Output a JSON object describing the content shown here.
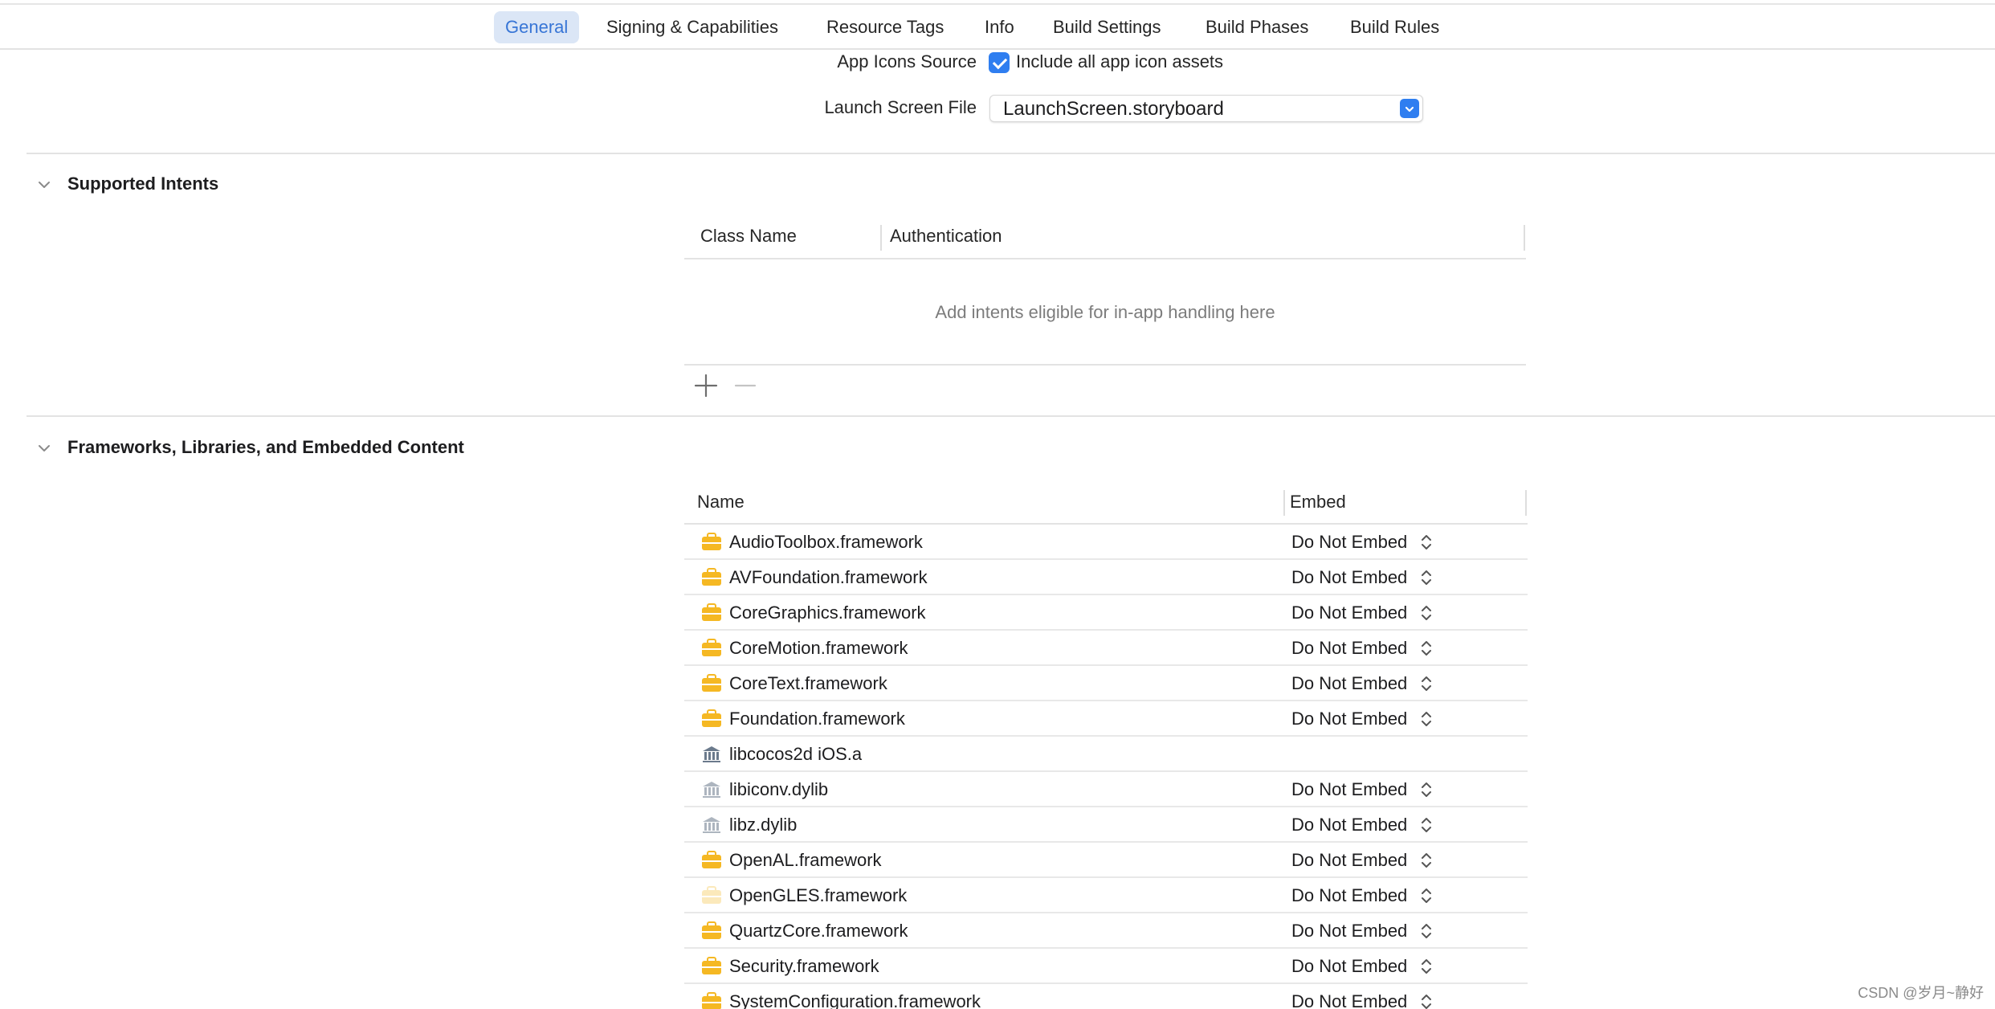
{
  "tabs": [
    {
      "label": "General",
      "active": true
    },
    {
      "label": "Signing & Capabilities",
      "active": false
    },
    {
      "label": "Resource Tags",
      "active": false
    },
    {
      "label": "Info",
      "active": false
    },
    {
      "label": "Build Settings",
      "active": false
    },
    {
      "label": "Build Phases",
      "active": false
    },
    {
      "label": "Build Rules",
      "active": false
    }
  ],
  "app_icons": {
    "label": "App Icons Source",
    "checkbox_label": "Include all app icon assets",
    "checked": true
  },
  "launch_screen": {
    "label": "Launch Screen File",
    "value": "LaunchScreen.storyboard"
  },
  "supported_intents": {
    "title": "Supported Intents",
    "columns": [
      "Class Name",
      "Authentication"
    ],
    "empty_message": "Add intents eligible for in-app handling here",
    "add_symbol": "+",
    "remove_symbol": "−"
  },
  "frameworks": {
    "title": "Frameworks, Libraries, and Embedded Content",
    "columns": [
      "Name",
      "Embed"
    ],
    "rows": [
      {
        "name": "AudioToolbox.framework",
        "embed": "Do Not Embed",
        "icon": "toolbox-icon"
      },
      {
        "name": "AVFoundation.framework",
        "embed": "Do Not Embed",
        "icon": "toolbox-icon"
      },
      {
        "name": "CoreGraphics.framework",
        "embed": "Do Not Embed",
        "icon": "toolbox-icon"
      },
      {
        "name": "CoreMotion.framework",
        "embed": "Do Not Embed",
        "icon": "toolbox-icon"
      },
      {
        "name": "CoreText.framework",
        "embed": "Do Not Embed",
        "icon": "toolbox-icon"
      },
      {
        "name": "Foundation.framework",
        "embed": "Do Not Embed",
        "icon": "toolbox-icon"
      },
      {
        "name": "libcocos2d iOS.a",
        "embed": "",
        "icon": "library-icon"
      },
      {
        "name": "libiconv.dylib",
        "embed": "Do Not Embed",
        "icon": "library-icon"
      },
      {
        "name": "libz.dylib",
        "embed": "Do Not Embed",
        "icon": "library-icon"
      },
      {
        "name": "OpenAL.framework",
        "embed": "Do Not Embed",
        "icon": "toolbox-icon"
      },
      {
        "name": "OpenGLES.framework",
        "embed": "Do Not Embed",
        "icon": "toolbox-icon"
      },
      {
        "name": "QuartzCore.framework",
        "embed": "Do Not Embed",
        "icon": "toolbox-icon"
      },
      {
        "name": "Security.framework",
        "embed": "Do Not Embed",
        "icon": "toolbox-icon"
      },
      {
        "name": "SystemConfiguration.framework",
        "embed": "Do Not Embed",
        "icon": "toolbox-icon"
      }
    ]
  },
  "watermark": "CSDN @岁月~静好",
  "colors": {
    "accent": "#2f7ef0",
    "tab_active_bg": "#dbe6f6",
    "tab_active_text": "#3775d6",
    "toolbox_icon": "#f5b823",
    "library_icon": "#6b7a8c"
  }
}
